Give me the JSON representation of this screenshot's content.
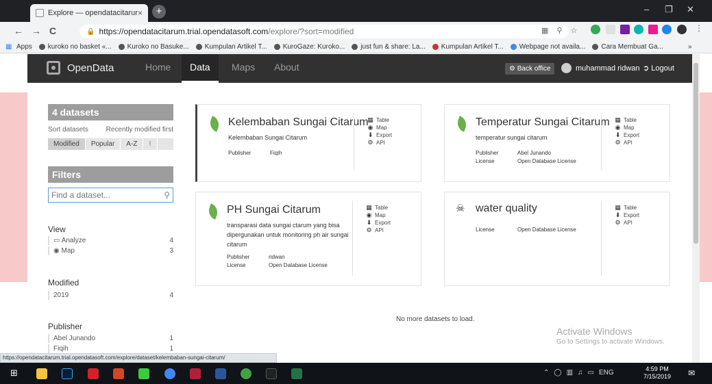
{
  "browser": {
    "tab_title": "Explore — opendatacitarum",
    "tab_close": "×",
    "new_tab": "+",
    "window_controls": [
      "–",
      "❐",
      "✕"
    ],
    "nav": {
      "back": "←",
      "forward": "→",
      "reload": "C"
    },
    "url_host": "https://opendatacitarum.trial.opendatasoft.com",
    "url_path": "/explore/?sort=modified",
    "bookmarks": [
      "Apps",
      "kuroko no basket «...",
      "Kuroko no Basuke...",
      "Kumpulan Artikel T...",
      "KuroGaze: Kuroko...",
      "just fun & share: La...",
      "Kumpulan Artikel T...",
      "Webpage not availa...",
      "Cara Membuat Ga..."
    ],
    "bookmarks_more": "»",
    "status_url": "https://opendatacitarum.trial.opendatasoft.com/explore/dataset/kelembaban-sungai-citarum/"
  },
  "site": {
    "brand": "OpenData",
    "nav": [
      "Home",
      "Data",
      "Maps",
      "About"
    ],
    "back_office": "Back office",
    "user": "muhammad ridwan",
    "logout": "Logout"
  },
  "sidebar": {
    "count": "4 datasets",
    "sort_label": "Sort datasets",
    "sort_value": "Recently modified first",
    "sort_buttons": [
      "Modified",
      "Popular",
      "A-Z",
      "⁝"
    ],
    "filters": "Filters",
    "search_placeholder": "Find a dataset...",
    "view_title": "View",
    "view_items": [
      {
        "label": "Analyze",
        "count": "4"
      },
      {
        "label": "Map",
        "count": "3"
      }
    ],
    "modified_title": "Modified",
    "modified_items": [
      {
        "label": "2019",
        "count": "4"
      }
    ],
    "publisher_title": "Publisher",
    "publisher_items": [
      {
        "label": "Abel Junando",
        "count": "1"
      },
      {
        "label": "Fiqih",
        "count": "1"
      }
    ]
  },
  "cards": [
    {
      "title": "Kelembaban Sungai Citarum",
      "desc": "Kelembaban Sungai Citarum",
      "publisher_label": "Publisher",
      "publisher": "Fiqih",
      "actions": [
        "Table",
        "Map",
        "Export",
        "API"
      ]
    },
    {
      "title": "Temperatur Sungai Citarum",
      "desc": "temperatur sungai citarum",
      "publisher_label": "Publisher",
      "publisher": "Abel Junando",
      "license_label": "License",
      "license": "Open Database License",
      "actions": [
        "Table",
        "Map",
        "Export",
        "API"
      ]
    },
    {
      "title": "PH Sungai Citarum",
      "desc": "transparasi data sungai ctarum yang bisa dipergunakan untuk monitoring ph air sungai citarum",
      "publisher_label": "Publisher",
      "publisher": "ridwan",
      "license_label": "License",
      "license": "Open Database License",
      "actions": [
        "Table",
        "Map",
        "Export",
        "API"
      ]
    },
    {
      "title": "water quality",
      "license_label": "License",
      "license": "Open Database License",
      "actions": [
        "Table",
        "Export",
        "API"
      ]
    }
  ],
  "no_more": "No more datasets to load.",
  "watermark": {
    "title": "Activate Windows",
    "sub": "Go to Settings to activate Windows."
  },
  "taskbar": {
    "lang": "ENG",
    "time": "4:59 PM",
    "date": "7/15/2019"
  },
  "colors": {
    "navbar": "#313131",
    "sidebar_box": "#9d9d9d",
    "leaf": "#6ab04c",
    "edge": "#f8c9c9"
  }
}
